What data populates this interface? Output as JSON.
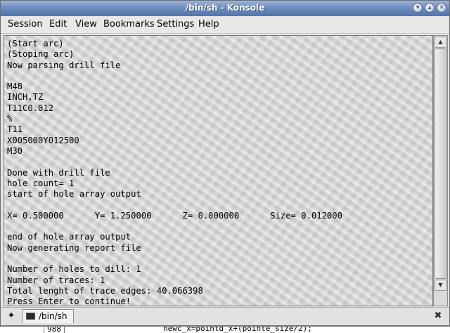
{
  "window": {
    "title": "/bin/sh - Konsole",
    "buttons": {
      "minimize": "▾",
      "maximize": "▴",
      "close": "✕"
    }
  },
  "menu": [
    "Session",
    "Edit",
    "View",
    "Bookmarks",
    "Settings",
    "Help"
  ],
  "terminal": {
    "lines": [
      "(Start arc)",
      "(Stoping arc)",
      "Now parsing drill file",
      "",
      "M48",
      "INCH,TZ",
      "T11C0.012",
      "%",
      "T11",
      "X005000Y012500",
      "M30",
      "",
      "Done with drill file",
      "hole count= 1",
      "start of hole array output",
      "",
      "X= 0.500000      Y= 1.250000      Z= 0.000000      Size= 0.012000",
      "",
      "end of hole array output",
      "Now generating report file",
      "",
      "Number of holes to dill: 1",
      "Number of traces: 1",
      "Total lenght of trace edges: 40.066398",
      "Press Enter to continue!"
    ]
  },
  "scrollbar": {
    "up_arrow": "▲",
    "down_arrow": "▼"
  },
  "tabbar": {
    "new_tab_icon": "✦",
    "tab_label": "/bin/sh",
    "close_icon": "✖"
  },
  "background_editor": {
    "line_number": "988",
    "code": "newc_x=pointd_x+(pointe_size/2);"
  }
}
